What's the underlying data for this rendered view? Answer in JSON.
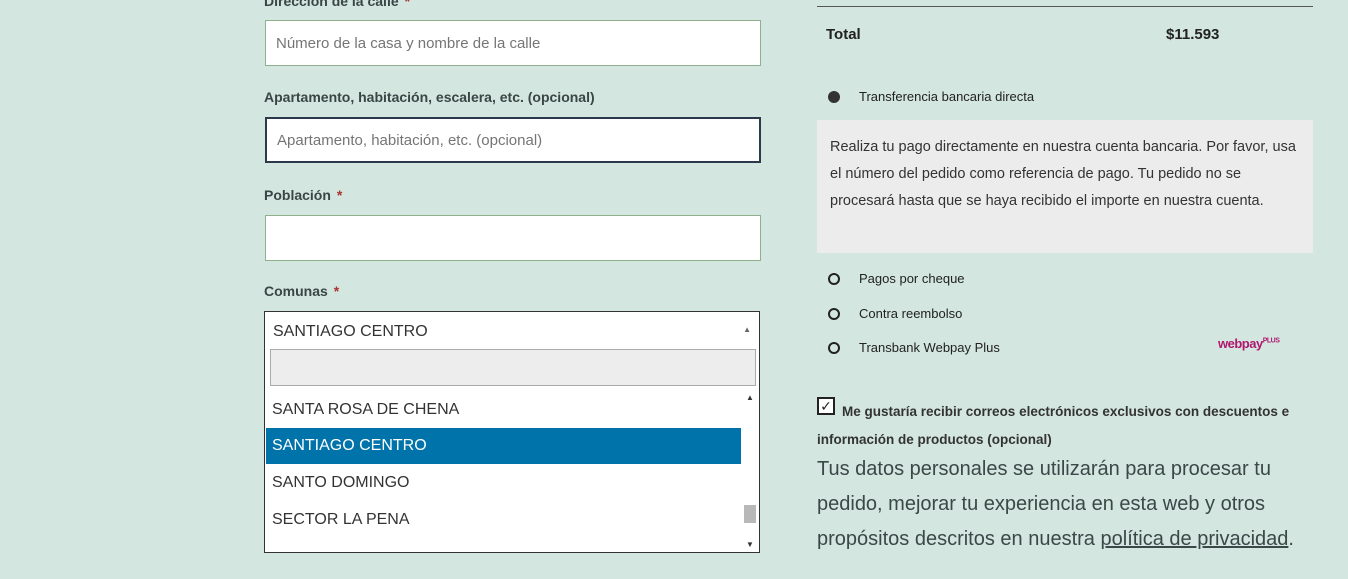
{
  "form": {
    "address": {
      "label": "Dirección de la calle",
      "required_mark": "*",
      "placeholder": "Número de la casa y nombre de la calle"
    },
    "apartment": {
      "label": "Apartamento, habitación, escalera, etc. (opcional)",
      "placeholder": "Apartamento, habitación, etc. (opcional)"
    },
    "city": {
      "label": "Población",
      "required_mark": "*",
      "value": ""
    },
    "comuna": {
      "label": "Comunas",
      "required_mark": "*",
      "selected": "SANTIAGO CENTRO",
      "options": [
        "SANTA ROSA DE CHENA",
        "SANTIAGO CENTRO",
        "SANTO DOMINGO",
        "SECTOR LA PENA"
      ],
      "selected_index": 1
    }
  },
  "order": {
    "total_label": "Total",
    "total_value": "$11.593"
  },
  "payment": {
    "methods": [
      {
        "label": "Transferencia bancaria directa",
        "checked": true
      },
      {
        "label": "Pagos por cheque",
        "checked": false
      },
      {
        "label": "Contra reembolso",
        "checked": false
      },
      {
        "label": "Transbank Webpay Plus",
        "checked": false
      }
    ],
    "bank_description": "Realiza tu pago directamente en nuestra cuenta bancaria. Por favor, usa el número del pedido como referencia de pago. Tu pedido no se procesará hasta que se haya recibido el importe en nuestra cuenta.",
    "webpay_logo": "webpay",
    "webpay_logo_sup": "PLUS"
  },
  "newsletter": {
    "checked": true,
    "check_mark": "✓",
    "label": "Me gustaría recibir correos electrónicos exclusivos con descuentos e información de productos (opcional)"
  },
  "privacy": {
    "text": "Tus datos personales se utilizarán para procesar tu pedido, mejorar tu experiencia en esta web y otros propósitos descritos en nuestra",
    "link": "política de privacidad",
    "end": "."
  },
  "colors": {
    "background": "#d3e6df",
    "selected_option": "#0073aa",
    "webpay": "#b0176e"
  }
}
